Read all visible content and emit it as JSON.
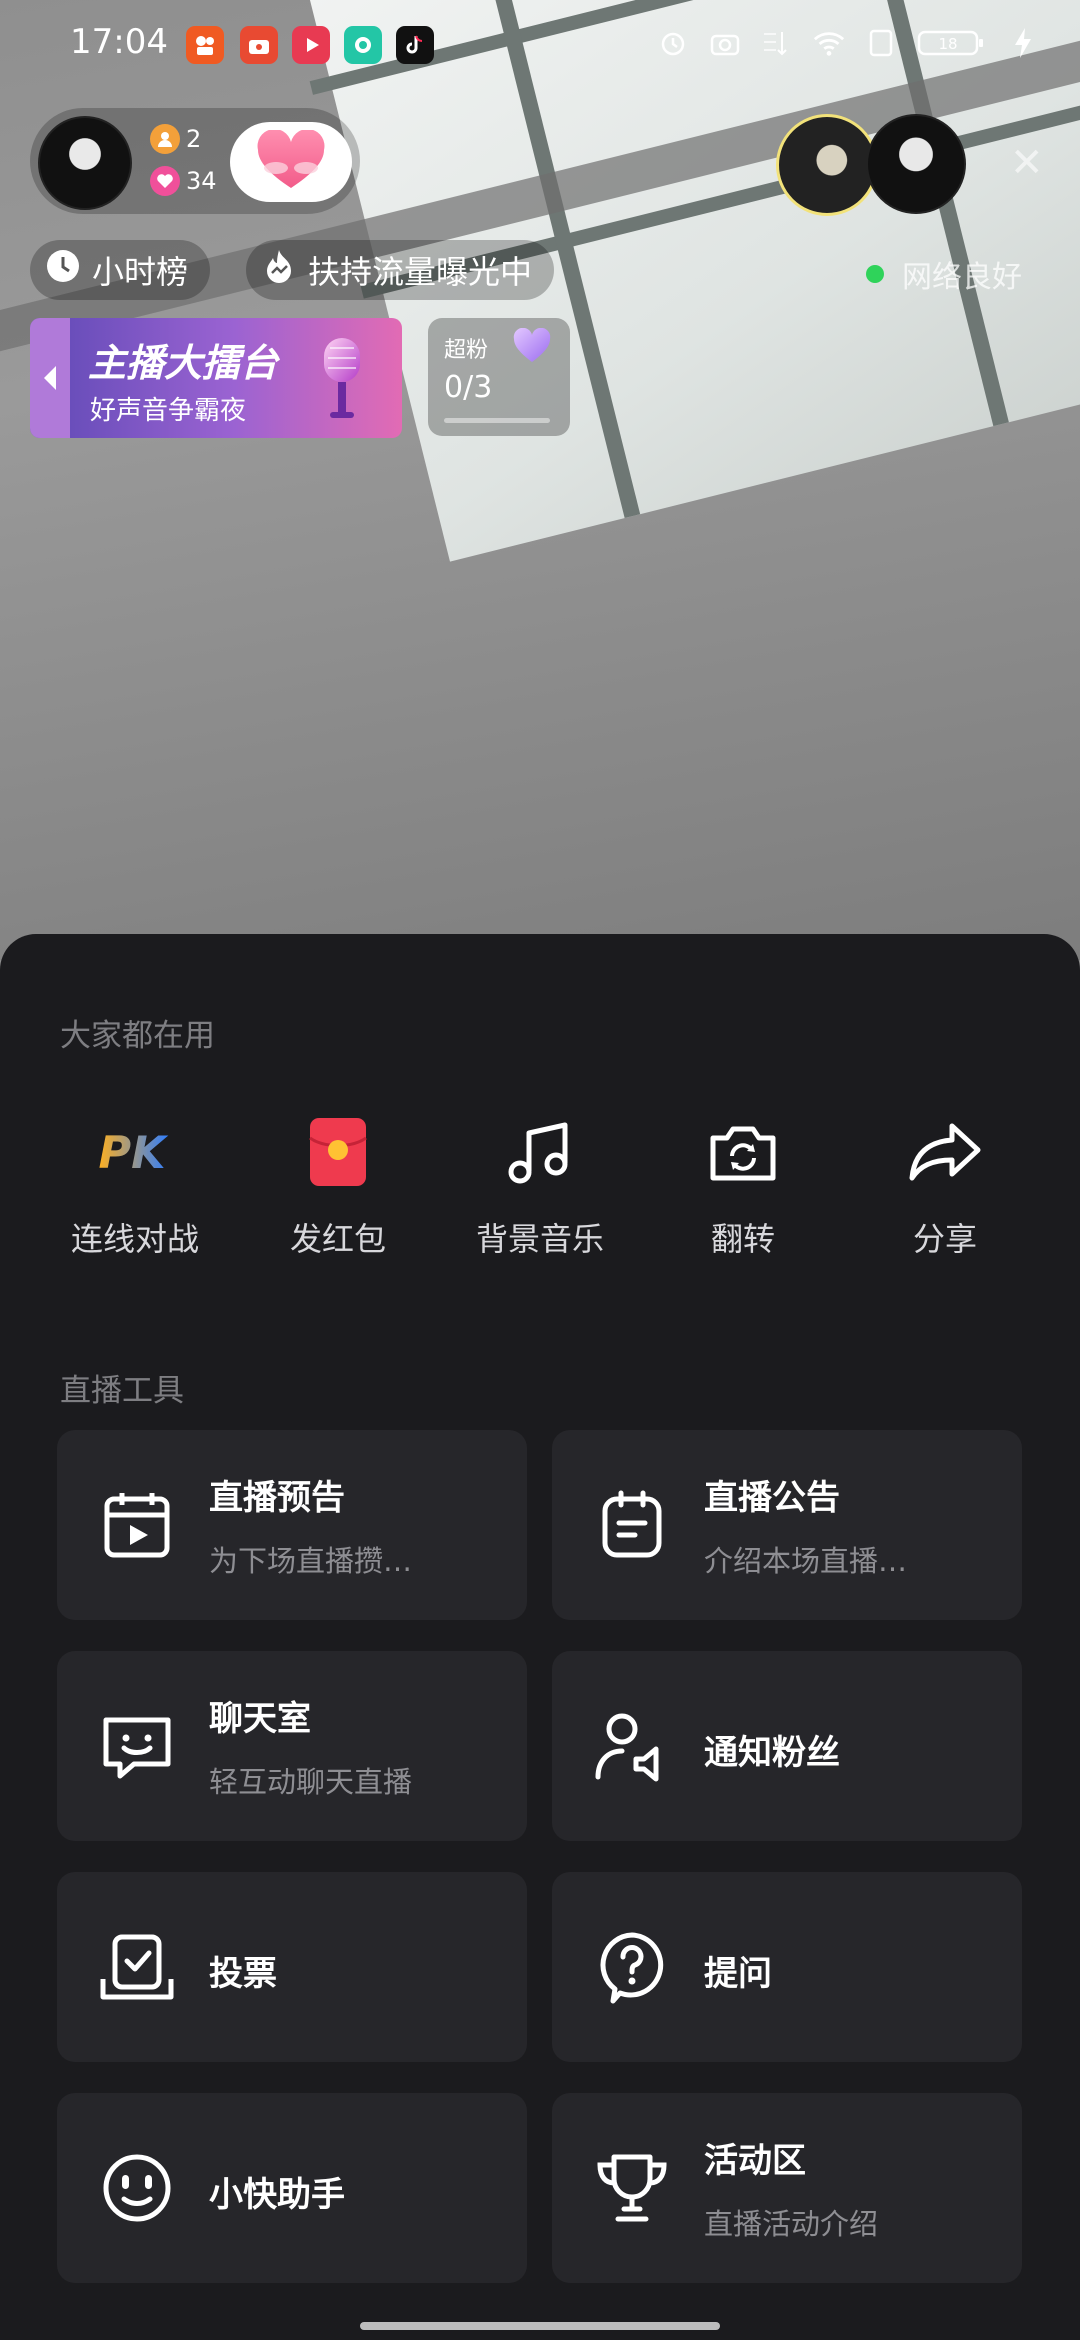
{
  "status_bar": {
    "time": "17:04",
    "apps": [
      {
        "icon": "kuaishou-app-icon",
        "color": "#f05a22"
      },
      {
        "icon": "toutiao-app-icon",
        "color": "#e84a32"
      },
      {
        "icon": "video-app-icon",
        "color": "#e83a52"
      },
      {
        "icon": "chat-app-icon",
        "color": "#23c6a6"
      },
      {
        "icon": "douyin-app-icon",
        "color": "#111111"
      }
    ],
    "network_speed": "",
    "battery": "18"
  },
  "host": {
    "viewers_count": "2",
    "likes_count": "34"
  },
  "chips": {
    "hour_rank": "小时榜",
    "traffic_boost": "扶持流量曝光中"
  },
  "network_status": "网络良好",
  "banner": {
    "title": "主播大擂台",
    "subtitle": "好声音争霸夜"
  },
  "superfan": {
    "label": "超粉",
    "count": "0/3",
    "progress": 0
  },
  "sheet": {
    "popular_title": "大家都在用",
    "quick_actions": [
      {
        "label": "连线对战",
        "icon": "pk-icon"
      },
      {
        "label": "发红包",
        "icon": "red-envelope-icon"
      },
      {
        "label": "背景音乐",
        "icon": "music-note-icon"
      },
      {
        "label": "翻转",
        "icon": "camera-flip-icon"
      },
      {
        "label": "分享",
        "icon": "share-icon"
      }
    ],
    "tools_title": "直播工具",
    "tools": [
      {
        "title": "直播预告",
        "subtitle": "为下场直播攒…",
        "icon": "calendar-play-icon"
      },
      {
        "title": "直播公告",
        "subtitle": "介绍本场直播…",
        "icon": "notice-board-icon"
      },
      {
        "title": "聊天室",
        "subtitle": "轻互动聊天直播",
        "icon": "chat-face-icon"
      },
      {
        "title": "通知粉丝",
        "subtitle": "",
        "icon": "notify-fans-icon"
      },
      {
        "title": "投票",
        "subtitle": "",
        "icon": "vote-icon"
      },
      {
        "title": "提问",
        "subtitle": "",
        "icon": "question-icon"
      },
      {
        "title": "小快助手",
        "subtitle": "",
        "icon": "assistant-face-icon"
      },
      {
        "title": "活动区",
        "subtitle": "直播活动介绍",
        "icon": "trophy-icon"
      }
    ]
  },
  "colors": {
    "sheet_bg": "#1b1b1e",
    "card_bg": "#26262a",
    "accent_red": "#ef3a4e",
    "pk_gradient_start": "#ffb020",
    "pk_gradient_end": "#2d7dff",
    "online_green": "#2fd35a"
  }
}
